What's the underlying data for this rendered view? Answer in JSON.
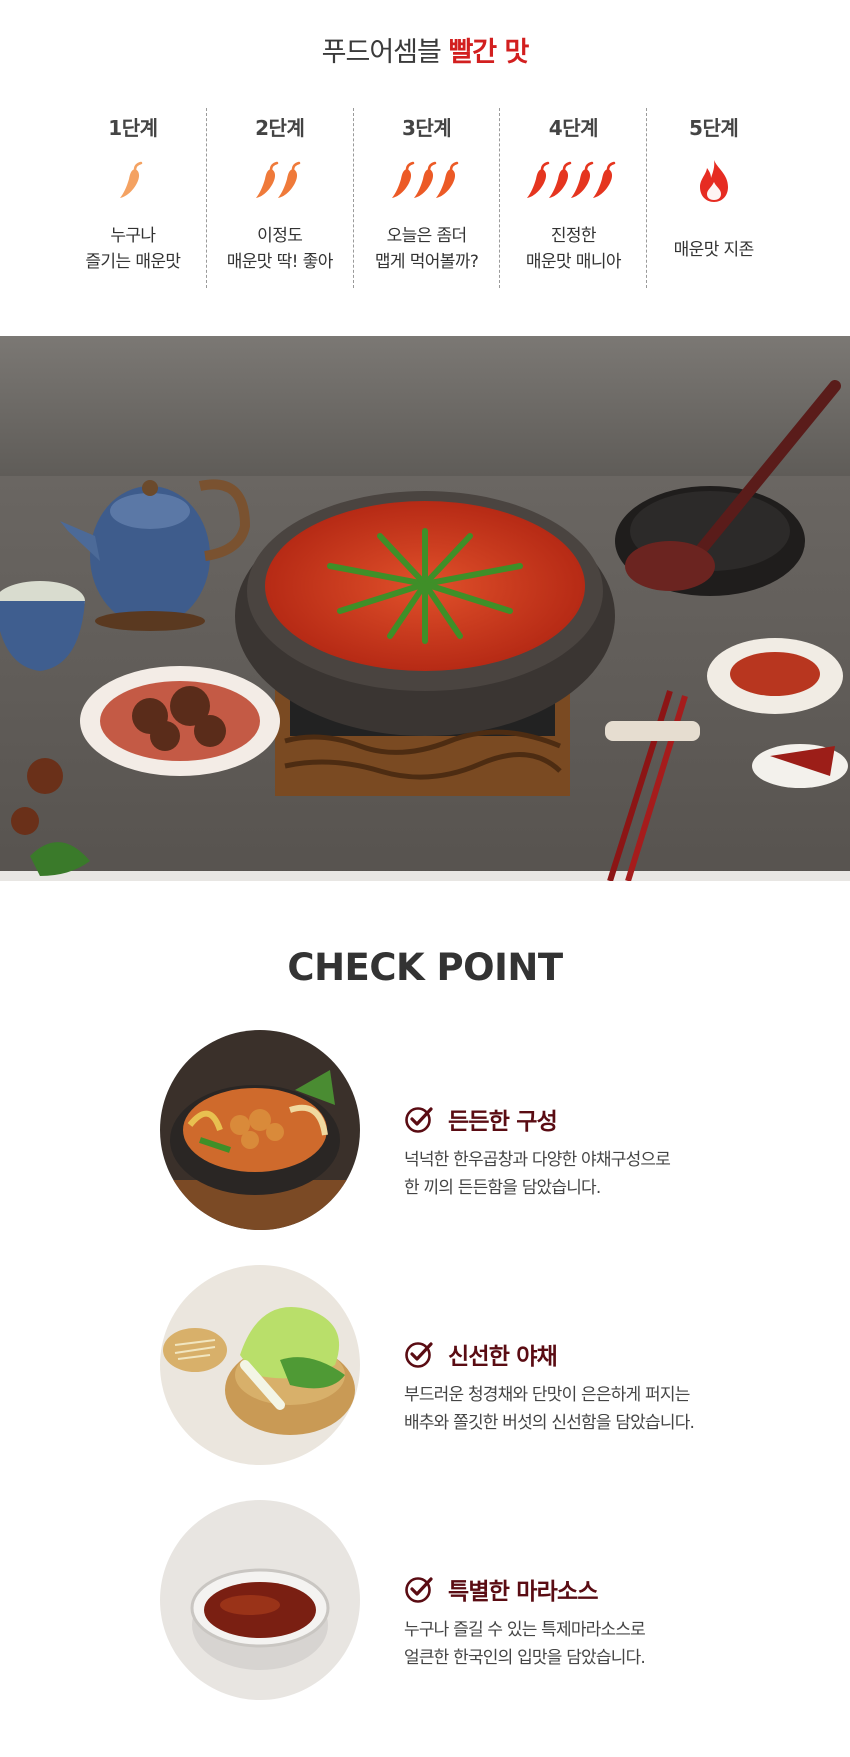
{
  "spice_title": {
    "prefix": "푸드어셈블",
    "highlight": "빨간 맛"
  },
  "levels": [
    {
      "label": "1단계",
      "desc_line1": "누구나",
      "desc_line2": "즐기는 매운맛",
      "peppers": 1,
      "icon": "chili-pepper-icon"
    },
    {
      "label": "2단계",
      "desc_line1": "이정도",
      "desc_line2": "매운맛 딱! 좋아",
      "peppers": 2,
      "icon": "chili-pepper-icon"
    },
    {
      "label": "3단계",
      "desc_line1": "오늘은 좀더",
      "desc_line2": "맵게 먹어볼까?",
      "peppers": 3,
      "icon": "chili-pepper-icon"
    },
    {
      "label": "4단계",
      "desc_line1": "진정한",
      "desc_line2": "매운맛 매니아",
      "peppers": 4,
      "icon": "chili-pepper-icon"
    },
    {
      "label": "5단계",
      "desc_line1": "매운맛 지존",
      "desc_line2": "",
      "peppers": 0,
      "icon": "fire-icon"
    }
  ],
  "colors": {
    "pepper_1": "#f4a262",
    "pepper_2": "#ef7a3a",
    "pepper_3": "#ec5a26",
    "pepper_4": "#e5351f",
    "fire": "#e62c22",
    "accent_red": "#d21f1f",
    "point_title": "#5a0c13"
  },
  "check_title": "CHECK POINT",
  "points": [
    {
      "title": "든든한 구성",
      "line1": "넉넉한 한우곱창과 다양한 야채구성으로",
      "line2": "한 끼의 든든함을 담았습니다."
    },
    {
      "title": "신선한 야채",
      "line1": "부드러운 청경채와 단맛이 은은하게 퍼지는",
      "line2": "배추와 쫄깃한 버섯의 신선함을 담았습니다."
    },
    {
      "title": "특별한 마라소스",
      "line1": "누구나 즐길 수 있는 특제마라소스로",
      "line2": "얼큰한 한국인의 입맛을 담았습니다."
    }
  ]
}
